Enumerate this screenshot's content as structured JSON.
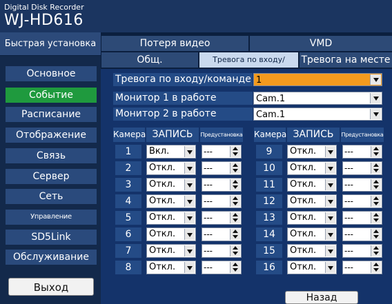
{
  "header": {
    "line1": "Digital Disk Recorder",
    "model": "WJ-HD616"
  },
  "sidebar": {
    "quick_setup": "Быстрая установка",
    "items": [
      {
        "label": "Основное",
        "active": false
      },
      {
        "label": "Событие",
        "active": true
      },
      {
        "label": "Расписание",
        "active": false
      },
      {
        "label": "Отображение",
        "active": false
      },
      {
        "label": "Связь",
        "active": false
      },
      {
        "label": "Сервер",
        "active": false
      },
      {
        "label": "Сеть",
        "active": false
      },
      {
        "label": "Управление пользователем",
        "active": false
      },
      {
        "label": "SD5Link",
        "active": false
      },
      {
        "label": "Обслуживание",
        "active": false
      }
    ],
    "exit_label": "Выход"
  },
  "tabs": {
    "row1": [
      "Потеря видео",
      "VMD"
    ],
    "row2": [
      "Общ.",
      "Тревога по входу/команде",
      "Тревога на месте"
    ]
  },
  "settings": {
    "alarm_input_label": "Тревога по входу/команде",
    "alarm_input_value": "1",
    "monitor1_label": "Монитор 1 в работе",
    "monitor1_value": "Cam.1",
    "monitor2_label": "Монитор 2 в работе",
    "monitor2_value": "Cam.1"
  },
  "table": {
    "headers": {
      "camera": "Камера",
      "record": "ЗАПИСЬ",
      "preset": "Предустановка"
    },
    "left": [
      {
        "cam": "1",
        "rec": "Вкл.",
        "preset": "---"
      },
      {
        "cam": "2",
        "rec": "Откл.",
        "preset": "---"
      },
      {
        "cam": "3",
        "rec": "Откл.",
        "preset": "---"
      },
      {
        "cam": "4",
        "rec": "Откл.",
        "preset": "---"
      },
      {
        "cam": "5",
        "rec": "Откл.",
        "preset": "---"
      },
      {
        "cam": "6",
        "rec": "Откл.",
        "preset": "---"
      },
      {
        "cam": "7",
        "rec": "Откл.",
        "preset": "---"
      },
      {
        "cam": "8",
        "rec": "Откл.",
        "preset": "---"
      }
    ],
    "right": [
      {
        "cam": "9",
        "rec": "Откл.",
        "preset": "---"
      },
      {
        "cam": "10",
        "rec": "Откл.",
        "preset": "---"
      },
      {
        "cam": "11",
        "rec": "Откл.",
        "preset": "---"
      },
      {
        "cam": "12",
        "rec": "Откл.",
        "preset": "---"
      },
      {
        "cam": "13",
        "rec": "Откл.",
        "preset": "---"
      },
      {
        "cam": "14",
        "rec": "Откл.",
        "preset": "---"
      },
      {
        "cam": "15",
        "rec": "Откл.",
        "preset": "---"
      },
      {
        "cam": "16",
        "rec": "Откл.",
        "preset": "---"
      }
    ]
  },
  "footer": {
    "back_label": "Назад"
  },
  "colors": {
    "background": "#0b1f3e",
    "active_nav": "#1f9a3e",
    "highlight_select": "#f39a1e",
    "active_tab": "#c9d9ee"
  }
}
